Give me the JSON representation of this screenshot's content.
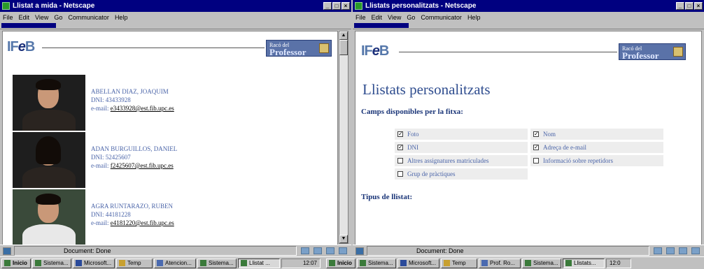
{
  "windows": [
    {
      "title": "Llistat a mida - Netscape",
      "menus": [
        "File",
        "Edit",
        "View",
        "Go",
        "Communicator",
        "Help"
      ],
      "status": "Document: Done",
      "logo": {
        "left": "IF",
        "e": "e",
        "right": "B"
      },
      "badge": {
        "small": "Racó del",
        "big": "Professor"
      },
      "students": [
        {
          "name": "ABELLAN DIAZ, JOAQUIM",
          "dni": "DNI: 43433928",
          "email_label": "e-mail:",
          "email": "e3433928@est.fib.upc.es"
        },
        {
          "name": "ADAN BURGUILLOS, DANIEL",
          "dni": "DNI: 52425607",
          "email_label": "e-mail:",
          "email": "f2425607@est.fib.upc.es"
        },
        {
          "name": "AGRA RUNTARAZO, RUBEN",
          "dni": "DNI: 44181228",
          "email_label": "e-mail:",
          "email": "e4181220@est.fib.upc.es"
        }
      ]
    },
    {
      "title": "Llistats personalitzats - Netscape",
      "menus": [
        "File",
        "Edit",
        "View",
        "Go",
        "Communicator",
        "Help"
      ],
      "status": "Document: Done",
      "logo": {
        "left": "IF",
        "e": "e",
        "right": "B"
      },
      "badge": {
        "small": "Racó del",
        "big": "Professor"
      },
      "page_title": "Llistats personalitzats",
      "fields_heading": "Camps disponibles per la fitxa:",
      "fields": [
        {
          "label": "Foto",
          "checked": true
        },
        {
          "label": "Nom",
          "checked": true
        },
        {
          "label": "DNI",
          "checked": true
        },
        {
          "label": "Adreça de e-mail",
          "checked": true
        },
        {
          "label": "Altres assignatures matriculades",
          "checked": false
        },
        {
          "label": "Informació sobre repetidors",
          "checked": false
        },
        {
          "label": "Grup de pràctiques",
          "checked": false
        }
      ],
      "list_type_heading": "Tipus de llistat:"
    }
  ],
  "taskbar": {
    "start": "Inicio",
    "left_items": [
      {
        "label": "Sistema...",
        "active": false
      },
      {
        "label": "Microsoft...",
        "active": false
      },
      {
        "label": "Temp",
        "active": false
      },
      {
        "label": "Atencion...",
        "active": false
      },
      {
        "label": "Sistema...",
        "active": false
      },
      {
        "label": "Llistat ...",
        "active": true
      }
    ],
    "clock_left": "12:07",
    "right_items": [
      {
        "label": "Sistema...",
        "active": false
      },
      {
        "label": "Microsoft...",
        "active": false
      },
      {
        "label": "Temp",
        "active": false
      },
      {
        "label": "Prof. Ro...",
        "active": false
      },
      {
        "label": "Sistema...",
        "active": false
      },
      {
        "label": "Llistats...",
        "active": true
      }
    ],
    "clock_right": "12:0"
  }
}
